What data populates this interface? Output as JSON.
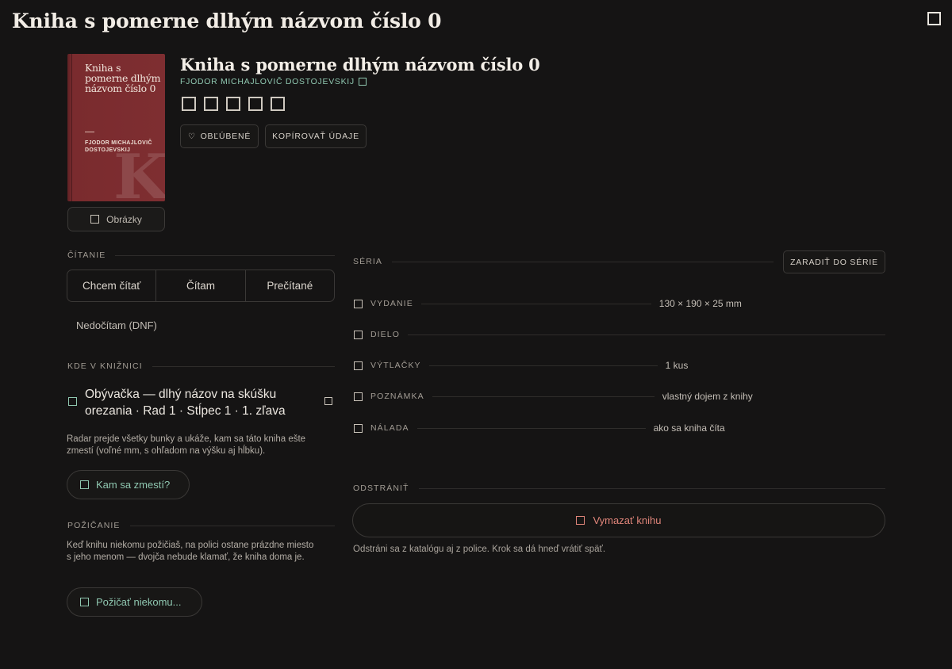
{
  "page": {
    "title": "Kniha s pomerne dlhým názvom číslo 0"
  },
  "cover": {
    "title": "Kniha s pomerne dlhým názvom číslo 0",
    "author": "FJODOR MICHAJLOVIČ DOSTOJEVSKIJ",
    "letter": "K"
  },
  "images_button": {
    "label": "Obrázky"
  },
  "book": {
    "title": "Kniha s pomerne dlhým názvom číslo 0",
    "author": "FJODOR MICHAJLOVIČ DOSTOJEVSKIJ",
    "rating": 0,
    "rating_max": 5
  },
  "actions": {
    "favorite": "OBĽÚBENÉ",
    "copy": "KOPÍROVAŤ ÚDAJE"
  },
  "reading": {
    "heading": "ČÍTANIE",
    "options": [
      "Chcem čítať",
      "Čítam",
      "Prečítané"
    ],
    "dnf": "Nedočítam (DNF)"
  },
  "location": {
    "heading": "KDE V KNIŽNICI",
    "value": "Obývačka — dlhý názov na skúšku orezania · Rad 1 · Stĺpec 1 · 1. zľava",
    "radar_desc": "Radar prejde všetky bunky a ukáže, kam sa táto kniha ešte zmestí (voľné mm, s ohľadom na výšku aj hĺbku).",
    "fit_button": "Kam sa zmestí?"
  },
  "lending": {
    "heading": "POŽIČANIE",
    "desc": "Keď knihu niekomu požičiaš, na polici ostane prázdne miesto s jeho menom — dvojča nebude klamať, že kniha doma je.",
    "button": "Požičať niekomu..."
  },
  "series": {
    "heading": "SÉRIA",
    "add_button": "ZARADIŤ DO SÉRIE"
  },
  "details": {
    "edition": {
      "label": "VYDANIE",
      "value": "130 × 190 × 25 mm"
    },
    "work": {
      "label": "DIELO",
      "value": ""
    },
    "copies": {
      "label": "VÝTLAČKY",
      "value": "1 kus"
    },
    "note": {
      "label": "POZNÁMKA",
      "value": "vlastný dojem z knihy"
    },
    "mood": {
      "label": "NÁLADA",
      "value": "ako sa kniha číta"
    }
  },
  "remove": {
    "heading": "ODSTRÁNIŤ",
    "button": "Vymazať knihu",
    "desc": "Odstráni sa z katalógu aj z police. Krok sa dá hneď vrátiť späť."
  },
  "colors": {
    "accent": "#8fc7b0",
    "danger": "#e0857a",
    "cover": "#7e2e31",
    "background": "#151414"
  }
}
